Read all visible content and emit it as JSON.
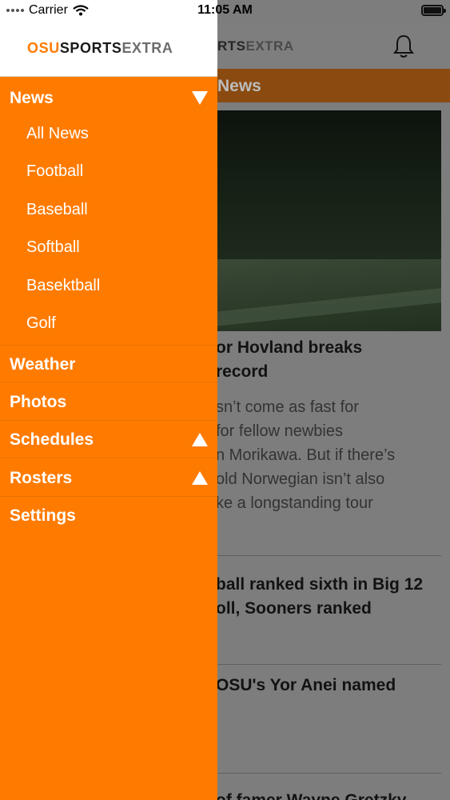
{
  "status_bar": {
    "carrier": "Carrier",
    "time": "11:05 AM"
  },
  "main": {
    "logo_sports": "RTS",
    "logo_extra": "EXTRA",
    "section": "News",
    "articles": [
      {
        "title_line1": "or Hovland breaks",
        "title_line2": "record",
        "body_lines": [
          "sn’t come as fast for",
          "for fellow newbies",
          "n Morikawa. But if there’s",
          "old Norwegian isn’t also",
          "ke a longstanding tour"
        ]
      },
      {
        "title_line1": "ball ranked sixth in Big 12",
        "title_line2": "oll, Sooners ranked"
      },
      {
        "title_line1": "OSU's Yor Anei named"
      },
      {
        "title_line1": "of famer Wayne Gretzky"
      }
    ]
  },
  "drawer": {
    "logo_osu": "OSU",
    "logo_sports": "SPORTS",
    "logo_extra": "EXTRA",
    "news": {
      "label": "News",
      "expanded": true,
      "sub_items": [
        "All News",
        "Football",
        "Baseball",
        "Softball",
        "Basektball",
        "Golf"
      ]
    },
    "weather": "Weather",
    "photos": "Photos",
    "schedules": "Schedules",
    "rosters": "Rosters",
    "settings": "Settings"
  },
  "colors": {
    "drawer_bg": "#ff7b00",
    "accent": "#ff7b00",
    "section_bar_dimmed": "#8a4a10"
  },
  "icons": [
    "wifi-icon",
    "battery-icon",
    "bell-icon",
    "triangle-down-icon",
    "triangle-up-icon"
  ]
}
